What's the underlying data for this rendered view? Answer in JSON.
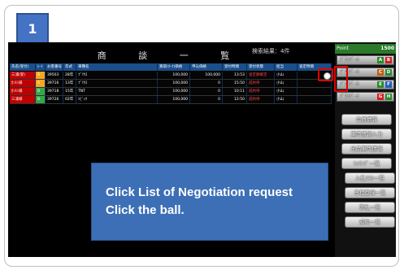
{
  "step": {
    "number": "1"
  },
  "list": {
    "title": "商 談 一 覧",
    "result_count": "検索結果：4件",
    "columns": [
      "氏名(受付)",
      "ﾚｰﾄ",
      "お客番号",
      "年式",
      "車種名",
      "買取(ｵｰｸ)価格",
      "申込価格",
      "受付時間",
      "受付状態",
      "担当",
      "査定時間"
    ],
    "rows": [
      [
        "三浦(受)",
        "A",
        "39503",
        "28年",
        "ﾌﾟﾘｳｽ",
        "100,000",
        "100,000",
        "13:53",
        "査定額確定",
        "小山",
        ""
      ],
      [
        "ｶﾝﾙﾐ様",
        "A",
        "39716",
        "13年",
        "ﾌﾟﾘｳｽ",
        "100,000",
        "0",
        "15:50",
        "成約待",
        "小山",
        ""
      ],
      [
        "ｶﾝﾙﾐ様",
        "B",
        "39718",
        "15年",
        "TNT",
        "100,000",
        "0",
        "10:11",
        "成約待",
        "小山",
        ""
      ],
      [
        "三浦様",
        "B",
        "39726",
        "02年",
        "ｼﾋﾞｯｸ",
        "100,000",
        "0",
        "12:50",
        "成約待",
        "小山",
        ""
      ]
    ],
    "rate_colors": [
      "orange",
      "orange",
      "green",
      "green"
    ]
  },
  "sidebar": {
    "header_label": "Point",
    "header_count": "1500",
    "categories": [
      {
        "label": "ﾌﾟﾗｲﾍﾞｰﾄ",
        "tag1": "A",
        "tag2": "B",
        "tag1_color": "#2a8a2a",
        "tag2_color": "#d02020"
      },
      {
        "label": "ﾌﾟﾗｲﾍﾞｰﾄ",
        "tag1": "C",
        "tag2": "D",
        "tag1_color": "#c06010",
        "tag2_color": "#2a8a2a"
      },
      {
        "label": "ﾌﾟﾗｲﾍﾞｰﾄ",
        "tag1": "E",
        "tag2": "F",
        "tag1_color": "#2a8a2a",
        "tag2_color": "#2060c0"
      },
      {
        "label": "ﾌﾟﾗｲﾍﾞｰﾄ",
        "tag1": "G",
        "tag2": "H",
        "tag1_color": "#d02020",
        "tag2_color": "#2a8a2a"
      }
    ],
    "buttons": [
      "会員情報",
      "車両情報入力",
      "出品車両情報",
      "ﾏｯﾁﾝｸﾞ一覧",
      "入札ﾘｽﾄ一覧",
      "日程登録一覧",
      "落札一覧",
      "成約一覧"
    ]
  },
  "callout": {
    "line1": "Click List of Negotiation request",
    "line2": "Click the ball."
  }
}
